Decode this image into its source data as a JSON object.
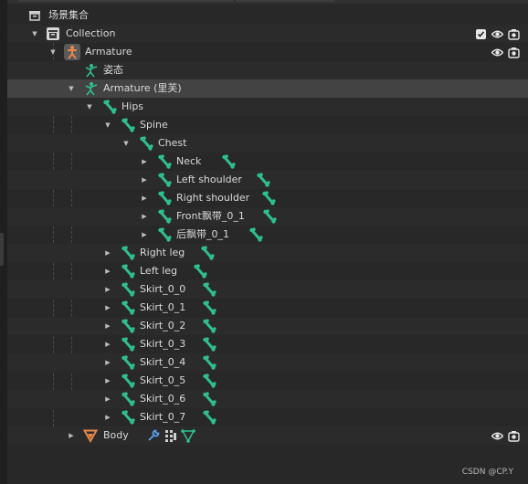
{
  "scene": {
    "label": "场景集合"
  },
  "collection": {
    "label": "Collection"
  },
  "armature_object": {
    "label": "Armature"
  },
  "pose": {
    "label": "姿态"
  },
  "armature_data": {
    "label": "Armature (里芙)"
  },
  "bones": {
    "hips": "Hips",
    "spine": "Spine",
    "chest": "Chest",
    "neck": "Neck",
    "left_shoulder": "Left shoulder",
    "right_shoulder": "Right shoulder",
    "front_ribbon": "Front飘带_0_1",
    "back_ribbon": "后飘带_0_1",
    "right_leg": "Right leg",
    "left_leg": "Left leg",
    "skirts": [
      "Skirt_0_0",
      "Skirt_0_1",
      "Skirt_0_2",
      "Skirt_0_3",
      "Skirt_0_4",
      "Skirt_0_5",
      "Skirt_0_6",
      "Skirt_0_7"
    ]
  },
  "body": {
    "label": "Body"
  },
  "watermark": "CSDN @CP.Y",
  "colors": {
    "bone": "#2fbf8f",
    "armature_orange": "#e8884a",
    "mesh_orange": "#e8884a"
  }
}
